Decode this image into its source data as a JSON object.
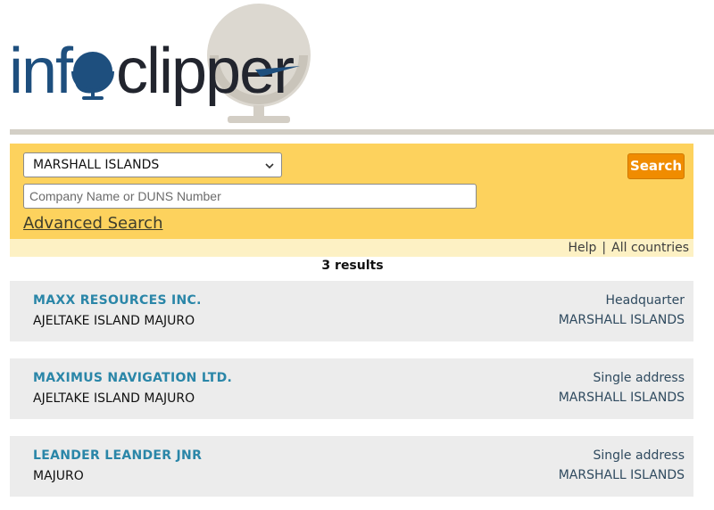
{
  "logo": {
    "text_part1": "info",
    "text_part2": "clipper"
  },
  "search": {
    "country_selected": "MARSHALL ISLANDS",
    "query_placeholder": "Company Name or DUNS Number",
    "query_value": "",
    "button_label": "Search",
    "advanced_link": "Advanced Search"
  },
  "subbar": {
    "help": "Help",
    "separator": "|",
    "all_countries": "All countries"
  },
  "results_count": "3 results",
  "results": [
    {
      "name": "MAXX RESOURCES INC.",
      "address": "AJELTAKE ISLAND MAJURO",
      "type": "Headquarter",
      "country": "MARSHALL ISLANDS"
    },
    {
      "name": "MAXIMUS NAVIGATION LTD.",
      "address": "AJELTAKE ISLAND MAJURO",
      "type": "Single address",
      "country": "MARSHALL ISLANDS"
    },
    {
      "name": "LEANDER LEANDER JNR",
      "address": "MAJURO",
      "type": "Single address",
      "country": "MARSHALL ISLANDS"
    }
  ],
  "colors": {
    "panel": "#fdd25d",
    "subbar": "#fdf1c4",
    "button": "#f08c00",
    "link": "#2a86a8",
    "logo_blue": "#1e4f7e",
    "logo_dark": "#22252e"
  },
  "icons": {
    "logo_globe": "globe-icon",
    "select_arrow": "chevron-down-icon"
  }
}
